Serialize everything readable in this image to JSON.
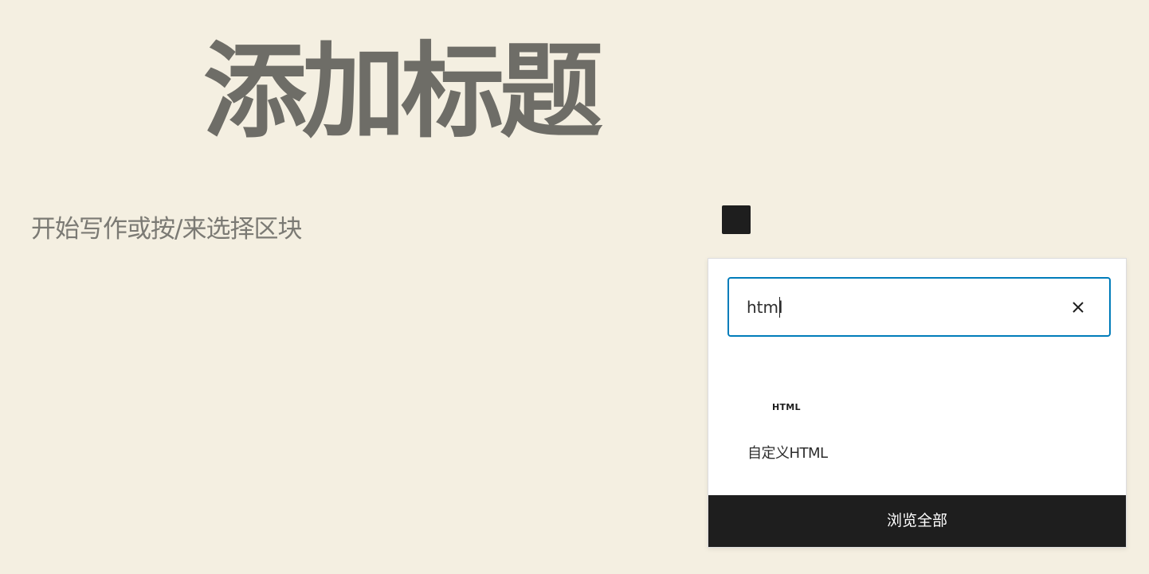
{
  "editor": {
    "post_title": "添加标题",
    "paragraph_placeholder": "开始写作或按/来选择区块"
  },
  "inserter": {
    "search": {
      "value": "html",
      "clear_icon": "close-icon"
    },
    "results": [
      {
        "icon_label": "HTML",
        "title": "自定义HTML"
      }
    ],
    "browse_all_label": "浏览全部"
  },
  "colors": {
    "background": "#f4efe1",
    "title_text": "#6e6d67",
    "accent": "#007cba",
    "dark": "#1e1e1e"
  }
}
